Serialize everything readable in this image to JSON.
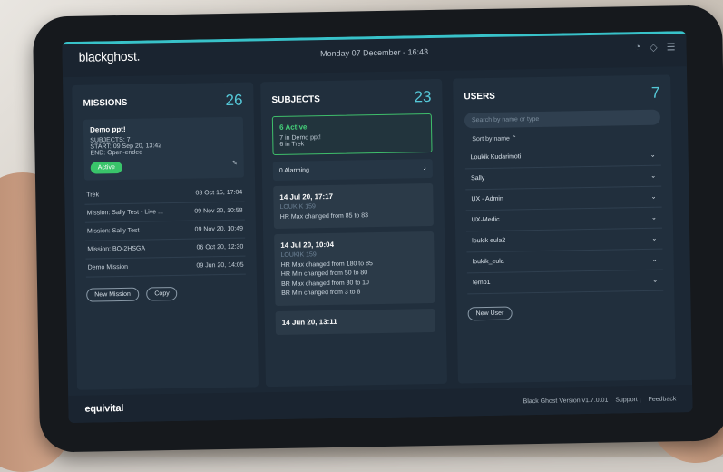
{
  "brand": "blackghost.",
  "datetime": "Monday 07 December - 16:43",
  "missions": {
    "title": "MISSIONS",
    "count": "26",
    "demo": {
      "name": "Demo ppt!",
      "subjects": "SUBJECTS: 7",
      "start": "START: 09 Sep 20, 13:42",
      "end": "END: Open-ended",
      "status": "Active"
    },
    "rows": [
      {
        "name": "Trek",
        "date": "08 Oct 15, 17:04"
      },
      {
        "name": "Mission: Sally Test - Live ...",
        "date": "09 Nov 20, 10:58"
      },
      {
        "name": "Mission: Sally Test",
        "date": "09 Nov 20, 10:49"
      },
      {
        "name": "Mission: BO-2HSGA",
        "date": "06 Oct 20, 12:30"
      },
      {
        "name": "Demo Mission",
        "date": "09 Jun 20, 14:05"
      }
    ],
    "new_btn": "New Mission",
    "copy_btn": "Copy"
  },
  "subjects": {
    "title": "SUBJECTS",
    "count": "23",
    "active": {
      "title": "6 Active",
      "l1": "7 in Demo ppt!",
      "l2": "6 in Trek"
    },
    "alarming": "0 Alarming",
    "notes": [
      {
        "h": "14 Jul 20, 17:17",
        "sub": "LOUKIK 159",
        "lines": [
          "HR Max changed from 85 to 83"
        ]
      },
      {
        "h": "14 Jul 20, 10:04",
        "sub": "LOUKIK 159",
        "lines": [
          "HR Max changed from 180 to 85",
          "HR Min changed from 50 to 80",
          "BR Max changed from 30 to 10",
          "BR Min changed from 3 to 8"
        ]
      },
      {
        "h": "14 Jun 20, 13:11",
        "sub": "",
        "lines": []
      }
    ]
  },
  "users": {
    "title": "USERS",
    "count": "7",
    "search_placeholder": "Search by name or type",
    "sort": "Sort by name",
    "list": [
      "Loukik Kudarimoti",
      "Sally",
      "UX - Admin",
      "UX-Medic",
      "loukik eula2",
      "loukik_eula",
      "temp1"
    ],
    "new_btn": "New User"
  },
  "footer": {
    "logo": "equivital",
    "version": "Black Ghost Version v1.7.0.01",
    "support": "Support",
    "feedback": "Feedback"
  }
}
